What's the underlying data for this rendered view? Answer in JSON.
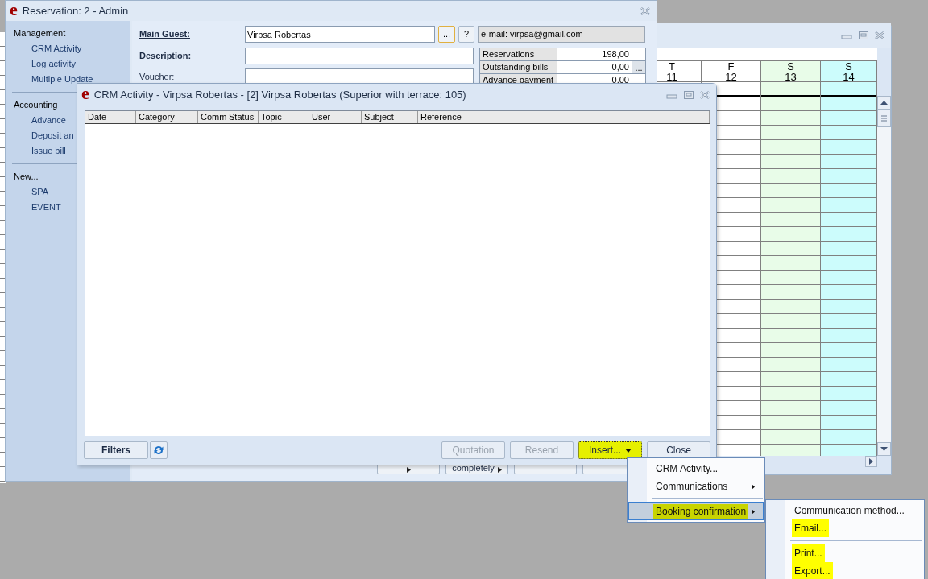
{
  "calendar_window": {
    "columns": [
      {
        "weekday": "T",
        "day": "11",
        "color": "#ffffff"
      },
      {
        "weekday": "F",
        "day": "12",
        "color": "#ffffff"
      },
      {
        "weekday": "S",
        "day": "13",
        "color": "#e8fce8"
      },
      {
        "weekday": "S",
        "day": "14",
        "color": "#ccfcfc"
      }
    ]
  },
  "reservation_window": {
    "logo": "e",
    "title": "Reservation: 2 - Admin",
    "sidebar": [
      {
        "heading": "Management",
        "items": [
          "CRM Activity",
          "Log activity",
          "Multiple Update"
        ]
      },
      {
        "heading": "Accounting",
        "items": [
          "Advance",
          "Deposit an",
          "Issue bill"
        ]
      },
      {
        "heading": "New...",
        "items": [
          "SPA",
          "EVENT"
        ]
      }
    ],
    "main_guest": {
      "label": "Main Guest:",
      "value": "Virpsa Robertas"
    },
    "browse_button": "...",
    "help_button": "?",
    "email": "e-mail: virpsa@gmail.com",
    "description": {
      "label": "Description:"
    },
    "voucher": {
      "label": "Voucher:"
    },
    "totals": [
      {
        "label": "Reservations",
        "value": "198,00"
      },
      {
        "label": "Outstanding bills",
        "value": "0,00",
        "button": "..."
      },
      {
        "label": "Advance payment",
        "value": "0,00"
      }
    ],
    "buttons": [
      {
        "menu": true
      },
      {
        "label": "completely",
        "menu": true
      },
      {
        "menu": false
      },
      {
        "menu": false
      }
    ]
  },
  "crm_window": {
    "logo": "e",
    "title": "CRM Activity - Virpsa Robertas - [2] Virpsa Robertas (Superior with terrace: 105)",
    "columns": [
      "Date",
      "Category",
      "Comm",
      "Status",
      "Topic",
      "User",
      "Subject",
      "Reference"
    ],
    "filters_button": "Filters",
    "buttons": [
      {
        "label": "Quotation",
        "disabled": true,
        "menu": false,
        "marked": false
      },
      {
        "label": "Resend",
        "disabled": true,
        "menu": false,
        "marked": false
      },
      {
        "label": "Insert...",
        "disabled": false,
        "menu": true,
        "marked": true
      },
      {
        "label": "Close",
        "disabled": false,
        "menu": false,
        "marked": false
      }
    ]
  },
  "insert_menu": [
    {
      "kind": "item",
      "label": "CRM Activity...",
      "selected": false,
      "marked": false
    },
    {
      "kind": "submenu",
      "label": "Communications",
      "selected": false,
      "marked": false
    },
    {
      "kind": "separator"
    },
    {
      "kind": "submenu",
      "label": "Booking confirmation",
      "selected": true,
      "marked": true
    }
  ],
  "booking_submenu": [
    {
      "kind": "item",
      "label": "Communication method...",
      "selected": false,
      "marked": false
    },
    {
      "kind": "item",
      "label": "Email...",
      "selected": false,
      "marked": true
    },
    {
      "kind": "separator"
    },
    {
      "kind": "item",
      "label": "Print...",
      "selected": false,
      "marked": true
    },
    {
      "kind": "item",
      "label": "Export...",
      "selected": false,
      "marked": true
    }
  ]
}
